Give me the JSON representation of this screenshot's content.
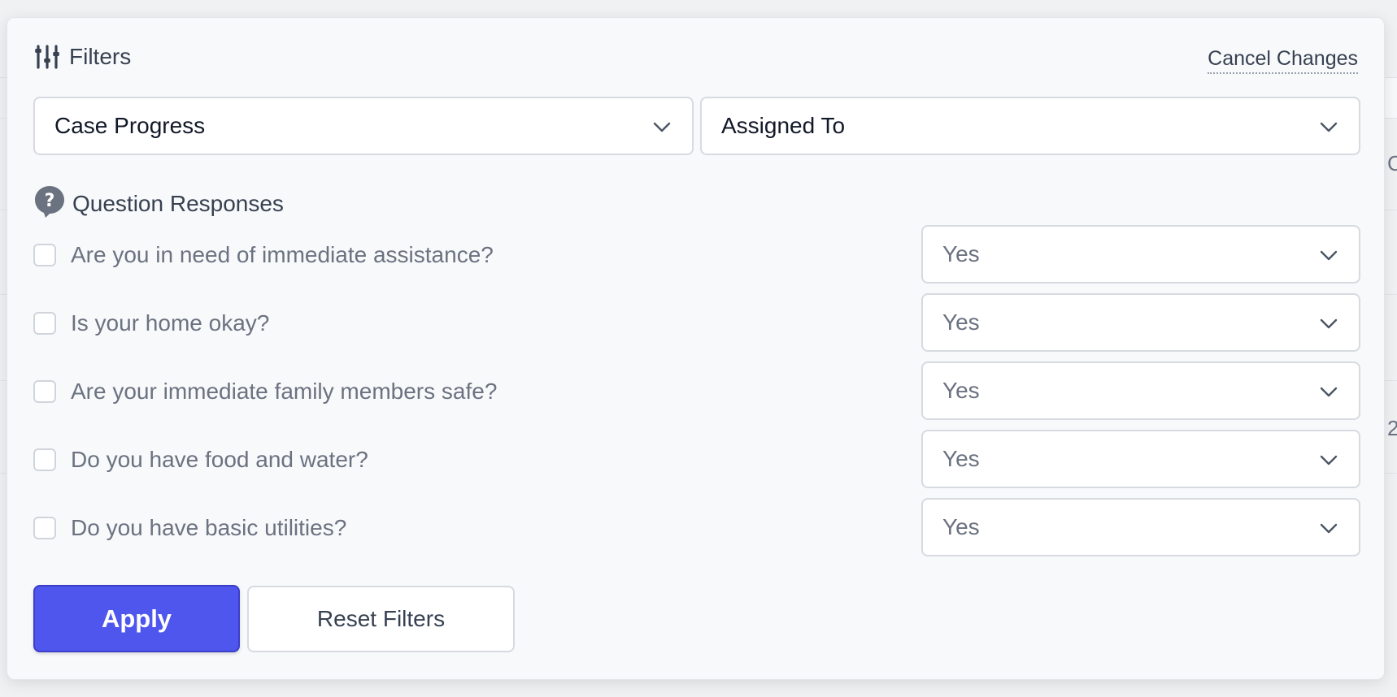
{
  "filters": {
    "title": "Filters",
    "cancel_label": "Cancel Changes",
    "case_progress_label": "Case Progress",
    "assigned_to_label": "Assigned To"
  },
  "questions": {
    "section_title": "Question Responses",
    "items": [
      {
        "text": "Are you in need of immediate assistance?",
        "answer": "Yes",
        "checked": false
      },
      {
        "text": "Is your home okay?",
        "answer": "Yes",
        "checked": false
      },
      {
        "text": "Are your immediate family members safe?",
        "answer": "Yes",
        "checked": false
      },
      {
        "text": "Do you have food and water?",
        "answer": "Yes",
        "checked": false
      },
      {
        "text": "Do you have basic utilities?",
        "answer": "Yes",
        "checked": false
      }
    ]
  },
  "actions": {
    "apply_label": "Apply",
    "reset_label": "Reset Filters"
  },
  "background": {
    "peek_1": "C",
    "peek_2": "2"
  },
  "colors": {
    "primary": "#4f56ee",
    "text_dark": "#374151",
    "text_muted": "#6b7280"
  },
  "icons": {
    "filters": "sliders-icon",
    "dropdown": "chevron-down-icon",
    "section": "question-bubble-icon"
  }
}
